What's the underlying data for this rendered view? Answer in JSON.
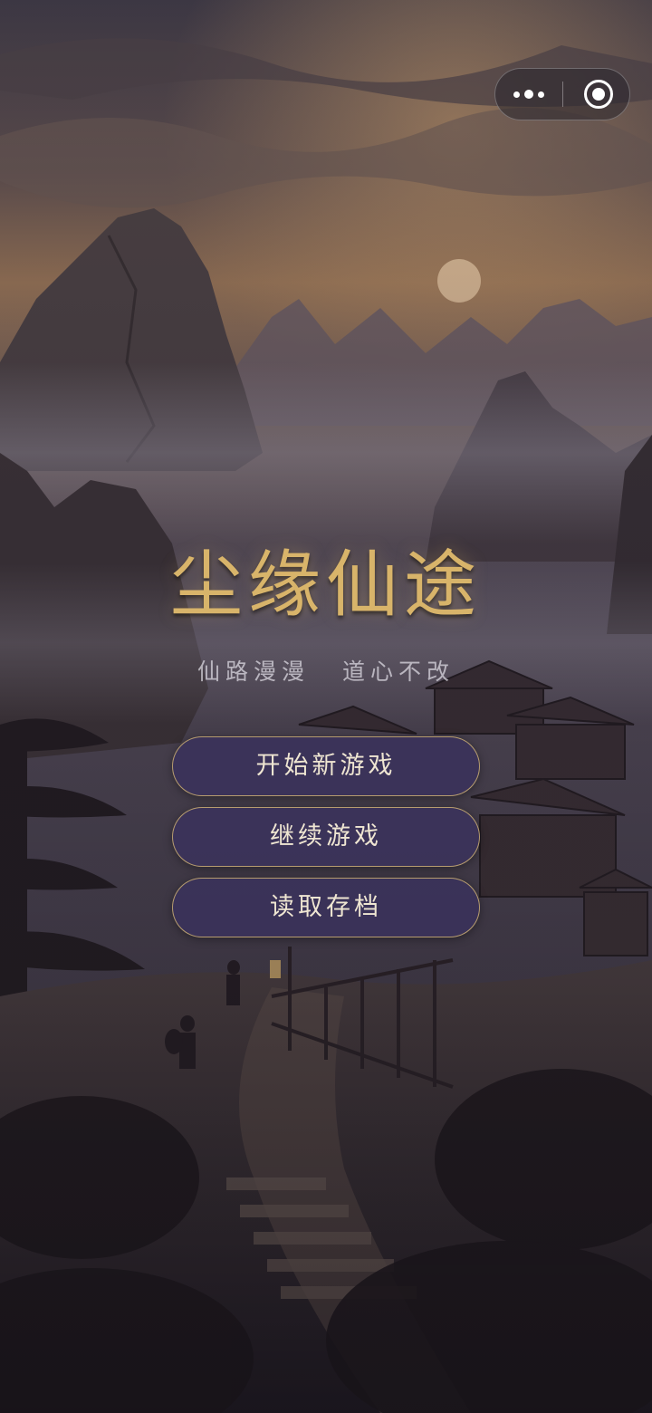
{
  "game": {
    "title": "尘缘仙途",
    "subtitle": "仙路漫漫 道心不改"
  },
  "menu": {
    "items": [
      {
        "label": "开始新游戏"
      },
      {
        "label": "继续游戏"
      },
      {
        "label": "读取存档"
      }
    ]
  },
  "capsule": {
    "more_icon": "more-dots-icon",
    "close_icon": "target-circle-icon"
  },
  "colors": {
    "title_gold": "#d8b46a",
    "button_bg": "#3a325c",
    "button_border": "#cdaf73",
    "button_text": "#efe6d2"
  }
}
